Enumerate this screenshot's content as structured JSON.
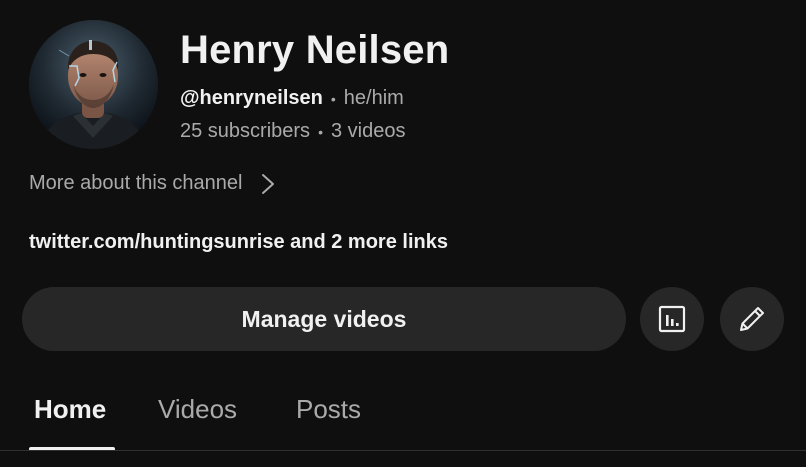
{
  "channel": {
    "name": "Henry Neilsen",
    "handle": "@henryneilsen",
    "pronouns": "he/him",
    "subscribers": "25 subscribers",
    "videos": "3 videos",
    "separator": "•"
  },
  "more_about": {
    "label": "More about this channel",
    "icon": "chevron-right-icon"
  },
  "links": {
    "text": "twitter.com/huntingsunrise and 2 more links"
  },
  "actions": {
    "manage_videos_label": "Manage videos",
    "analytics_icon": "analytics-icon",
    "edit_icon": "pencil-icon"
  },
  "tabs": [
    {
      "label": "Home",
      "active": true
    },
    {
      "label": "Videos",
      "active": false
    },
    {
      "label": "Posts",
      "active": false
    }
  ],
  "colors": {
    "background": "#0f0f0f",
    "surface": "#272727",
    "text_primary": "#f1f1f1",
    "text_secondary": "#aaaaaa"
  }
}
